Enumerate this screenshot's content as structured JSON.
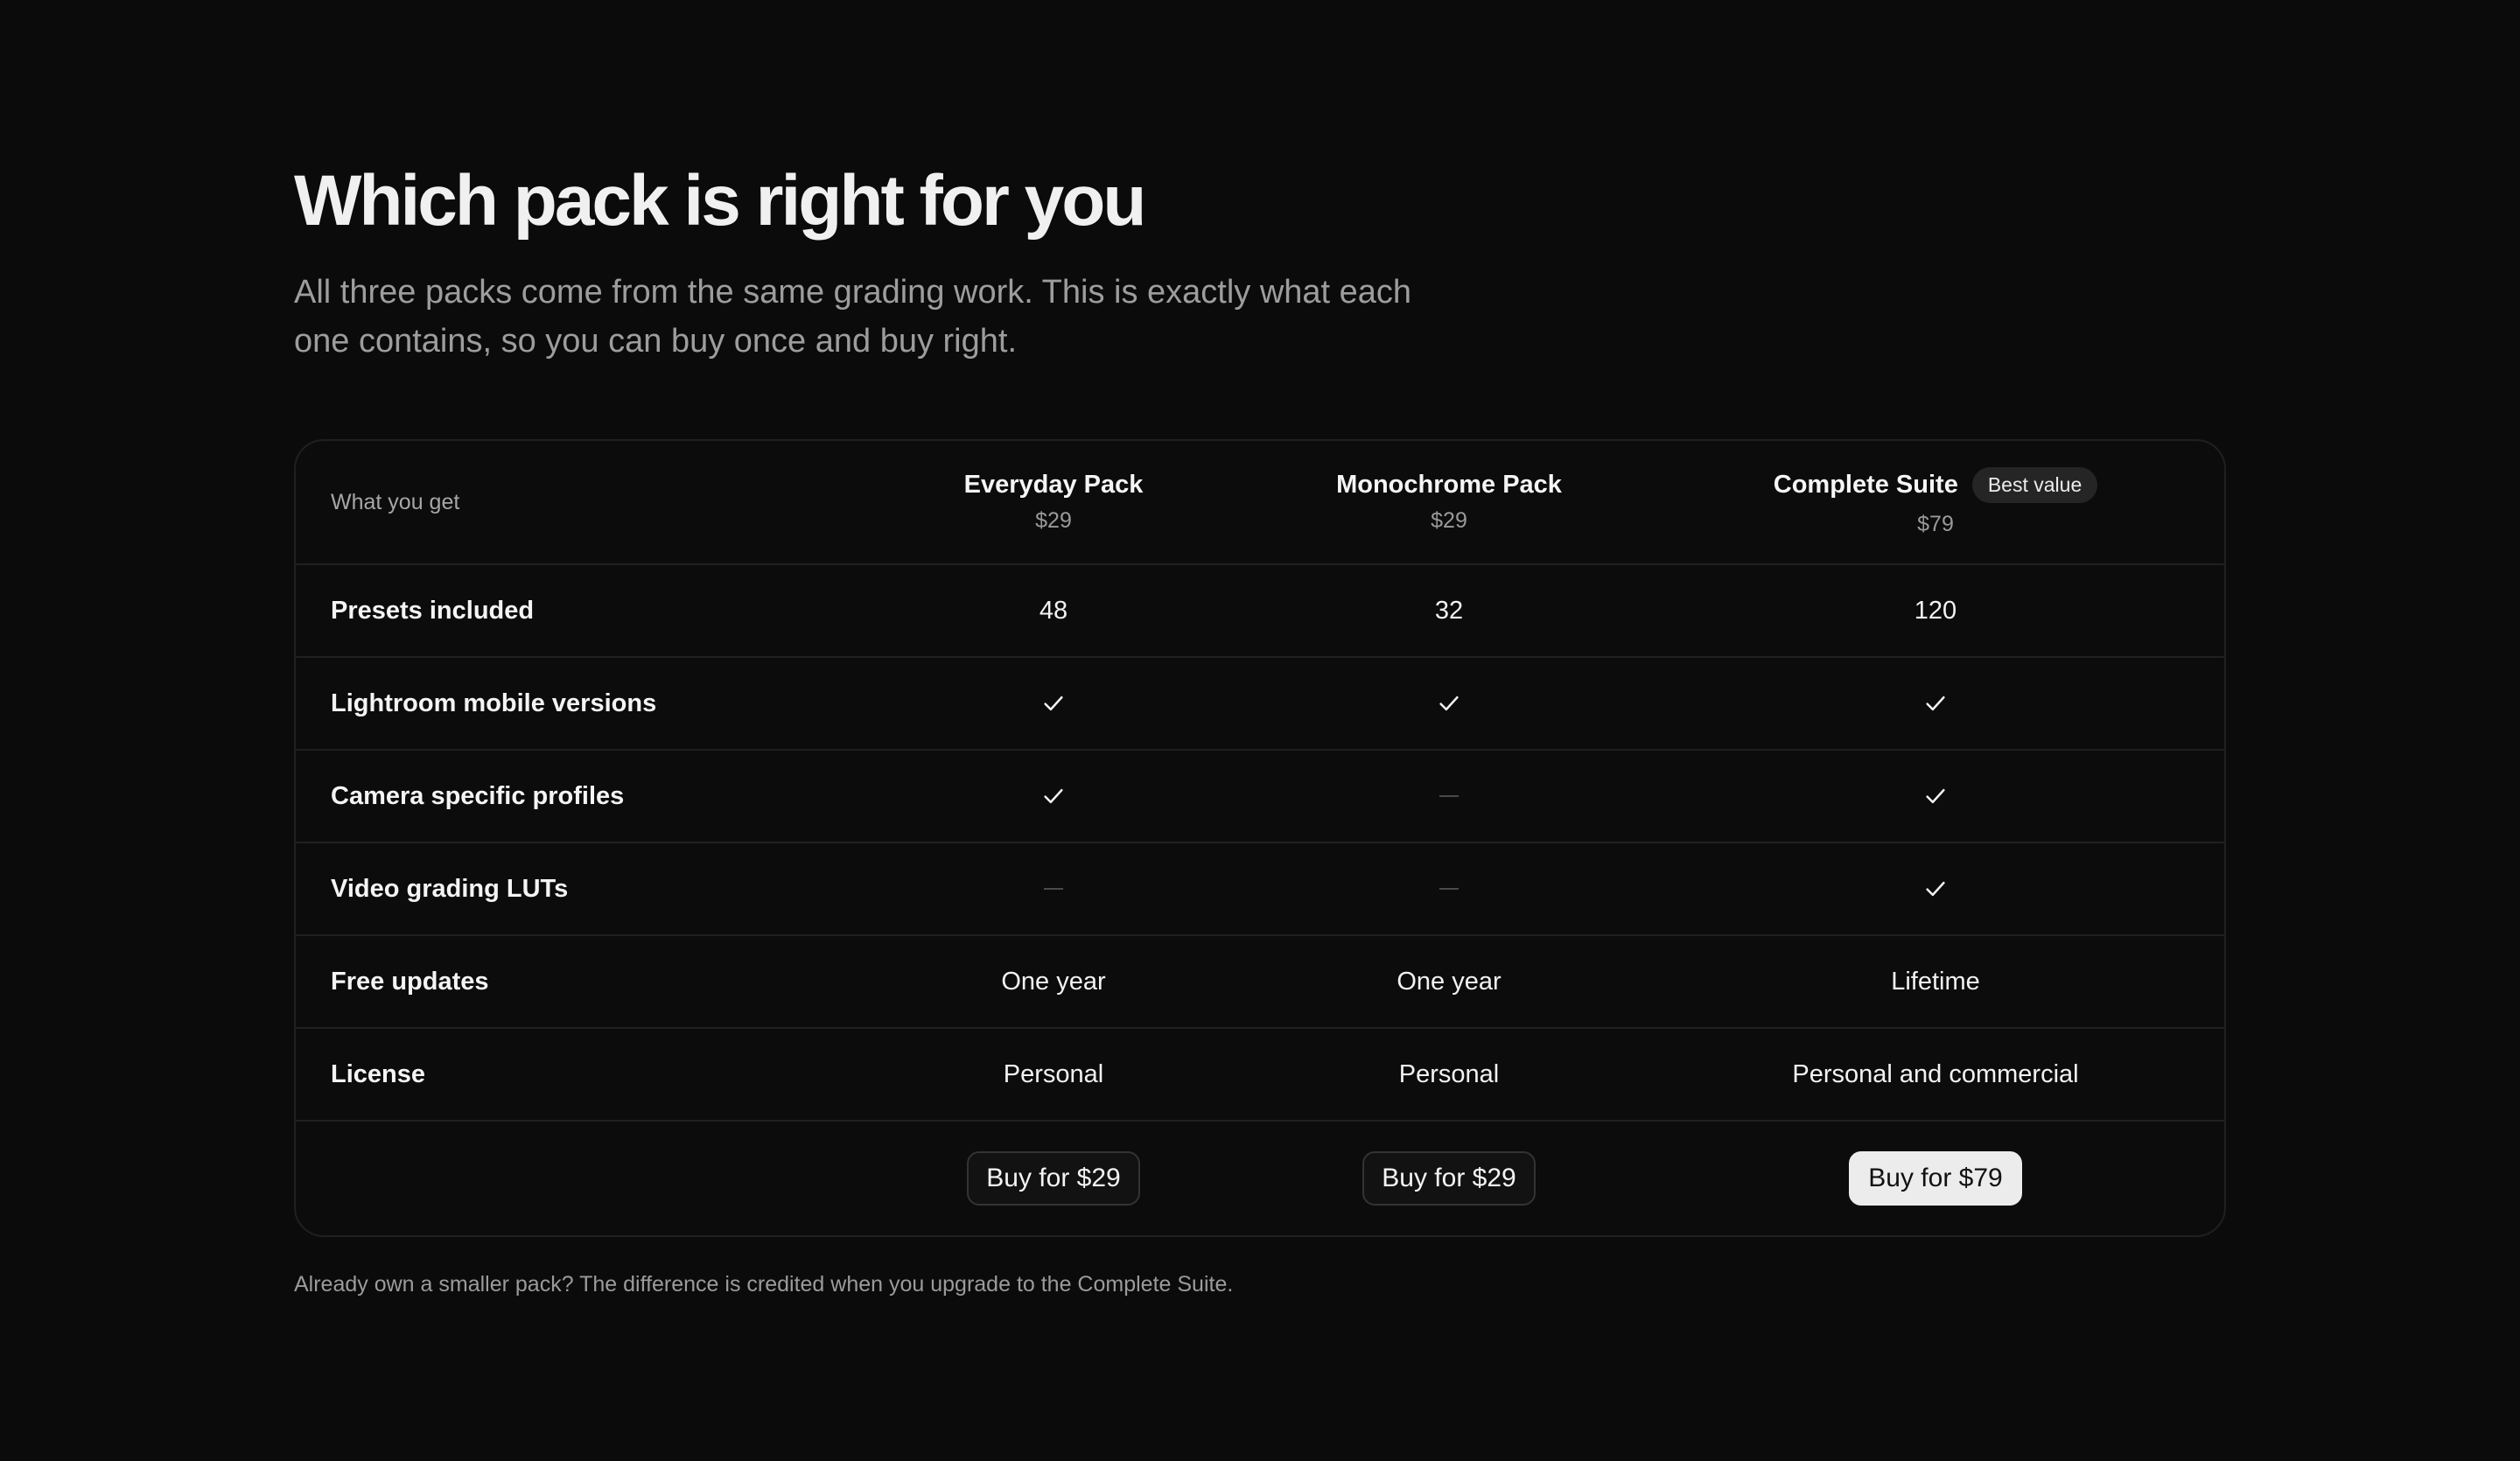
{
  "header": {
    "title": "Which pack is right for you",
    "subtitle": "All three packs come from the same grading work. This is exactly what each one contains, so you can buy once and buy right."
  },
  "table": {
    "corner_label": "What you get",
    "plans": [
      {
        "name": "Everyday Pack",
        "price": "$29",
        "badge": ""
      },
      {
        "name": "Monochrome Pack",
        "price": "$29",
        "badge": ""
      },
      {
        "name": "Complete Suite",
        "price": "$79",
        "badge": "Best value"
      }
    ],
    "rows": [
      {
        "label": "Presets included",
        "values": [
          {
            "type": "text",
            "text": "48"
          },
          {
            "type": "text",
            "text": "32"
          },
          {
            "type": "text",
            "text": "120"
          }
        ]
      },
      {
        "label": "Lightroom mobile versions",
        "values": [
          {
            "type": "check"
          },
          {
            "type": "check"
          },
          {
            "type": "check"
          }
        ]
      },
      {
        "label": "Camera specific profiles",
        "values": [
          {
            "type": "check"
          },
          {
            "type": "dash"
          },
          {
            "type": "check"
          }
        ]
      },
      {
        "label": "Video grading LUTs",
        "values": [
          {
            "type": "dash"
          },
          {
            "type": "dash"
          },
          {
            "type": "check"
          }
        ]
      },
      {
        "label": "Free updates",
        "values": [
          {
            "type": "text",
            "text": "One year"
          },
          {
            "type": "text",
            "text": "One year"
          },
          {
            "type": "text",
            "text": "Lifetime"
          }
        ]
      },
      {
        "label": "License",
        "values": [
          {
            "type": "text",
            "text": "Personal"
          },
          {
            "type": "text",
            "text": "Personal"
          },
          {
            "type": "text",
            "text": "Personal and commercial"
          }
        ]
      }
    ],
    "actions": [
      {
        "label": "Buy for $29",
        "primary": false
      },
      {
        "label": "Buy for $29",
        "primary": false
      },
      {
        "label": "Buy for $79",
        "primary": true
      }
    ]
  },
  "footnote": "Already own a smaller pack? The difference is credited when you upgrade to the Complete Suite.",
  "icons": {
    "included": "check-icon",
    "not_included": "dash-icon"
  },
  "colors": {
    "background": "#0b0b0b",
    "text": "#f2f2f2",
    "muted": "#9d9d9d",
    "border": "#202020",
    "badge_bg": "#252525",
    "primary_button": "#ececec"
  }
}
